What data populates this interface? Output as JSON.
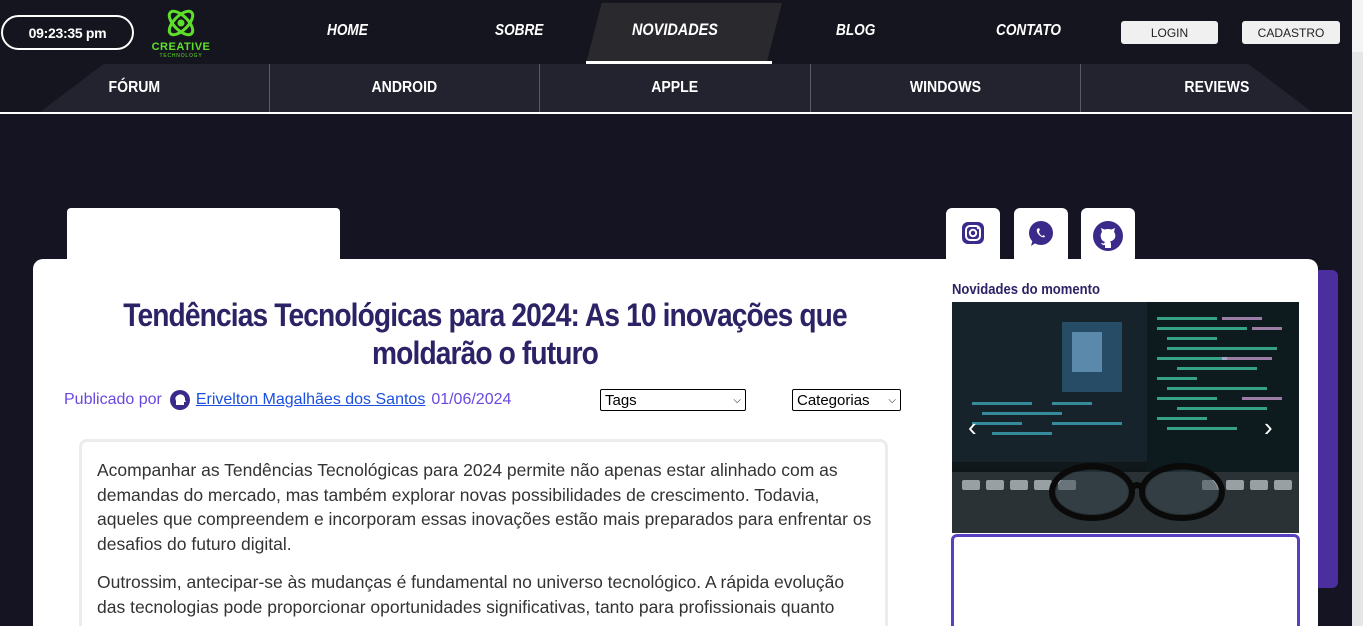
{
  "header": {
    "clock": "09:23:35 pm",
    "logo": {
      "title": "CREATIVE",
      "subtitle": "TECHNOLOGY",
      "icon": "atom-logo-icon"
    },
    "nav": [
      {
        "label": "HOME"
      },
      {
        "label": "SOBRE"
      },
      {
        "label": "NOVIDADES",
        "active": true
      },
      {
        "label": "BLOG"
      },
      {
        "label": "CONTATO"
      }
    ],
    "login_label": "LOGIN",
    "signup_label": "CADASTRO"
  },
  "subnav": [
    {
      "label": "FÓRUM"
    },
    {
      "label": "ANDROID"
    },
    {
      "label": "APPLE"
    },
    {
      "label": "WINDOWS"
    },
    {
      "label": "REVIEWS"
    }
  ],
  "social": [
    {
      "icon": "instagram-icon"
    },
    {
      "icon": "whatsapp-icon"
    },
    {
      "icon": "github-icon"
    }
  ],
  "article": {
    "title": "Tendências Tecnológicas para 2024: As 10 inovações que moldarão o futuro",
    "published_by": "Publicado por",
    "author": "Erivelton Magalhães dos Santos",
    "date": "01/06/2024",
    "tags_select": "Tags",
    "categories_select": "Categorias",
    "paragraphs": [
      "Acompanhar as Tendências Tecnológicas para 2024 permite não apenas estar alinhado com as demandas do mercado, mas também explorar novas possibilidades de crescimento. Todavia, aqueles que compreendem e incorporam essas inovações estão mais preparados para enfrentar os desafios do futuro digital.",
      "Outrossim, antecipar-se às mudanças é fundamental no universo tecnológico. A rápida evolução das tecnologias pode proporcionar oportunidades significativas, tanto para profissionais quanto"
    ]
  },
  "sidebar": {
    "title": "Novidades do momento",
    "carousel_prev": "‹",
    "carousel_next": "›"
  },
  "colors": {
    "background": "#141422",
    "title": "#2b2366",
    "accent_purple": "#4b2f9e",
    "logo_green": "#5ee02a"
  }
}
